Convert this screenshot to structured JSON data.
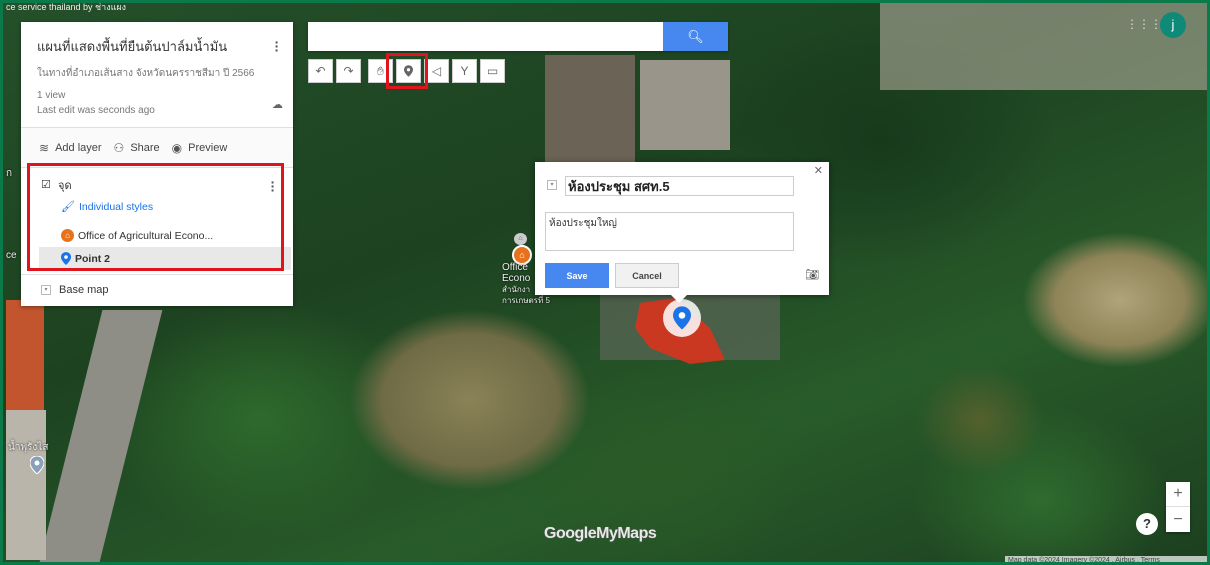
{
  "top_strip": {
    "text": "ce service   thailand by ช่างแผง"
  },
  "panel": {
    "title": "แผนที่แสดงพื้นที่ยืนต้นปาล์มน้ำมัน",
    "description": "ในทางที่อำเภอเส้นสาง จังหวัดนครราชสีมา ปี 2566",
    "views": "1 view",
    "last_edit": "Last edit was seconds ago",
    "actions": {
      "add_layer": "Add layer",
      "share": "Share",
      "preview": "Preview"
    },
    "layer": {
      "name": "จุด",
      "checked": true,
      "style_link": "Individual styles",
      "features": [
        {
          "label": "Office of Agricultural Econo...",
          "icon": "home-marker-icon",
          "color": "#e8711c"
        },
        {
          "label": "Point 2",
          "icon": "blue-pin-icon",
          "color": "#1a73e8",
          "selected": true
        }
      ]
    },
    "base_map": "Base map"
  },
  "search": {
    "value": "",
    "placeholder": "",
    "button_icon": "search-icon"
  },
  "toolbar": {
    "tools": [
      "undo-icon",
      "redo-icon",
      "hand-icon",
      "marker-icon",
      "draw-line-icon",
      "directions-icon",
      "ruler-icon"
    ],
    "active": "marker-icon"
  },
  "popup": {
    "title": "ห้องประชุม สศท.5",
    "description": "ห้องประชุมใหญ่",
    "save": "Save",
    "cancel": "Cancel"
  },
  "map_labels": {
    "office_line1": "Office",
    "office_line2": "Econo",
    "office_line3": "สำนักงา",
    "office_line4": "การเกษตรที่ 5",
    "left_label_1": "ก",
    "left_label_2": "ce",
    "water_label": "น้ำพุรังไส"
  },
  "account": {
    "initial": "j"
  },
  "zoom": {
    "in": "+",
    "out": "−"
  },
  "help": "?",
  "logo": "GoogleMyMaps",
  "attribution": "Map data ©2024 Imagery ©2024 , Airbus ,  Terms",
  "colors": {
    "accent_blue": "#4788f0",
    "highlight_red": "#e0141c",
    "frame_green": "#0a7a4a"
  }
}
